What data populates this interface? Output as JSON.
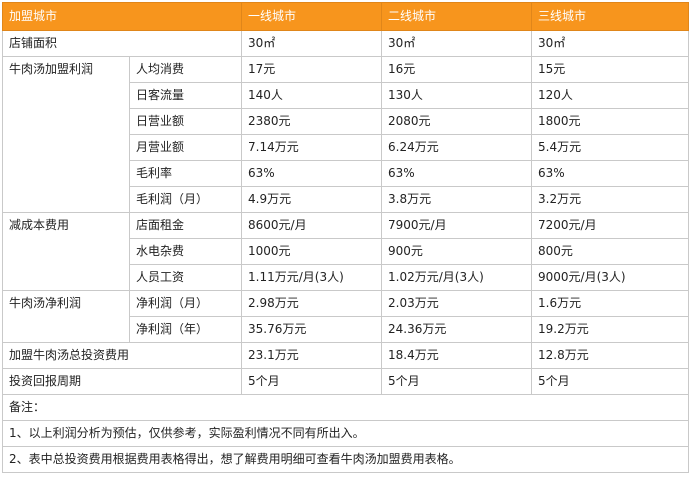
{
  "header": {
    "c0": "加盟城市",
    "c1": "一线城市",
    "c2": "二线城市",
    "c3": "三线城市"
  },
  "r0": {
    "label": "店铺面积",
    "v1": "30㎡",
    "v2": "30㎡",
    "v3": "30㎡"
  },
  "g1": {
    "label": "牛肉汤加盟利润",
    "rows": [
      {
        "label": "人均消费",
        "v1": "17元",
        "v2": "16元",
        "v3": "15元"
      },
      {
        "label": "日客流量",
        "v1": "140人",
        "v2": "130人",
        "v3": "120人"
      },
      {
        "label": "日营业额",
        "v1": "2380元",
        "v2": "2080元",
        "v3": "1800元"
      },
      {
        "label": "月营业额",
        "v1": "7.14万元",
        "v2": "6.24万元",
        "v3": "5.4万元"
      },
      {
        "label": "毛利率",
        "v1": "63%",
        "v2": "63%",
        "v3": "63%"
      },
      {
        "label": "毛利润（月）",
        "v1": "4.9万元",
        "v2": "3.8万元",
        "v3": "3.2万元"
      }
    ]
  },
  "g2": {
    "label": "减成本费用",
    "rows": [
      {
        "label": "店面租金",
        "v1": "8600元/月",
        "v2": "7900元/月",
        "v3": "7200元/月"
      },
      {
        "label": "水电杂费",
        "v1": "1000元",
        "v2": "900元",
        "v3": "800元"
      },
      {
        "label": "人员工资",
        "v1": "1.11万元/月(3人)",
        "v2": "1.02万元/月(3人)",
        "v3": "9000元/月(3人)"
      }
    ]
  },
  "g3": {
    "label": "牛肉汤净利润",
    "rows": [
      {
        "label": "净利润（月）",
        "v1": "2.98万元",
        "v2": "2.03万元",
        "v3": "1.6万元"
      },
      {
        "label": "净利润（年）",
        "v1": "35.76万元",
        "v2": "24.36万元",
        "v3": "19.2万元"
      }
    ]
  },
  "r_total": {
    "label": "加盟牛肉汤总投资费用",
    "v1": "23.1万元",
    "v2": "18.4万元",
    "v3": "12.8万元"
  },
  "r_payback": {
    "label": "投资回报周期",
    "v1": "5个月",
    "v2": "5个月",
    "v3": "5个月"
  },
  "notes": {
    "title": "备注：",
    "line1": "1、以上利润分析为预估，仅供参考，实际盈利情况不同有所出入。",
    "line2": "2、表中总投资费用根据费用表格得出，想了解费用明细可查看牛肉汤加盟费用表格。"
  }
}
